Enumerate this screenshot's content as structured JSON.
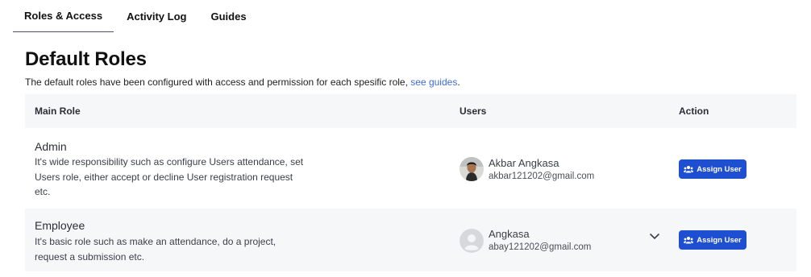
{
  "tabs": [
    {
      "label": "Roles & Access",
      "active": true
    },
    {
      "label": "Activity Log",
      "active": false
    },
    {
      "label": "Guides",
      "active": false
    }
  ],
  "page": {
    "title": "Default Roles",
    "description": "The default roles have been configured with access and permission for each spesific role,",
    "link_text": "see guides",
    "link_suffix": "."
  },
  "table": {
    "columns": [
      "Main Role",
      "Users",
      "Action"
    ],
    "rows": [
      {
        "role": "Admin",
        "description": "It's wide responsibility such as configure Users attendance, set Users role, either accept or decline User registration request etc.",
        "user_name": "Akbar Angkasa",
        "user_email": "akbar121202@gmail.com",
        "avatar": "photo-avatar",
        "action": "Assign User"
      },
      {
        "role": "Employee",
        "description": "It's basic role such as make an attendance, do a project, request a submission etc.",
        "user_name": "Angkasa",
        "user_email": "abay121202@gmail.com",
        "avatar": "default-user-avatar",
        "action": "Assign User"
      }
    ]
  },
  "colors": {
    "accent": "#1f4fd1",
    "link": "#3d6bd6",
    "header_bg": "#f6f7f9"
  }
}
